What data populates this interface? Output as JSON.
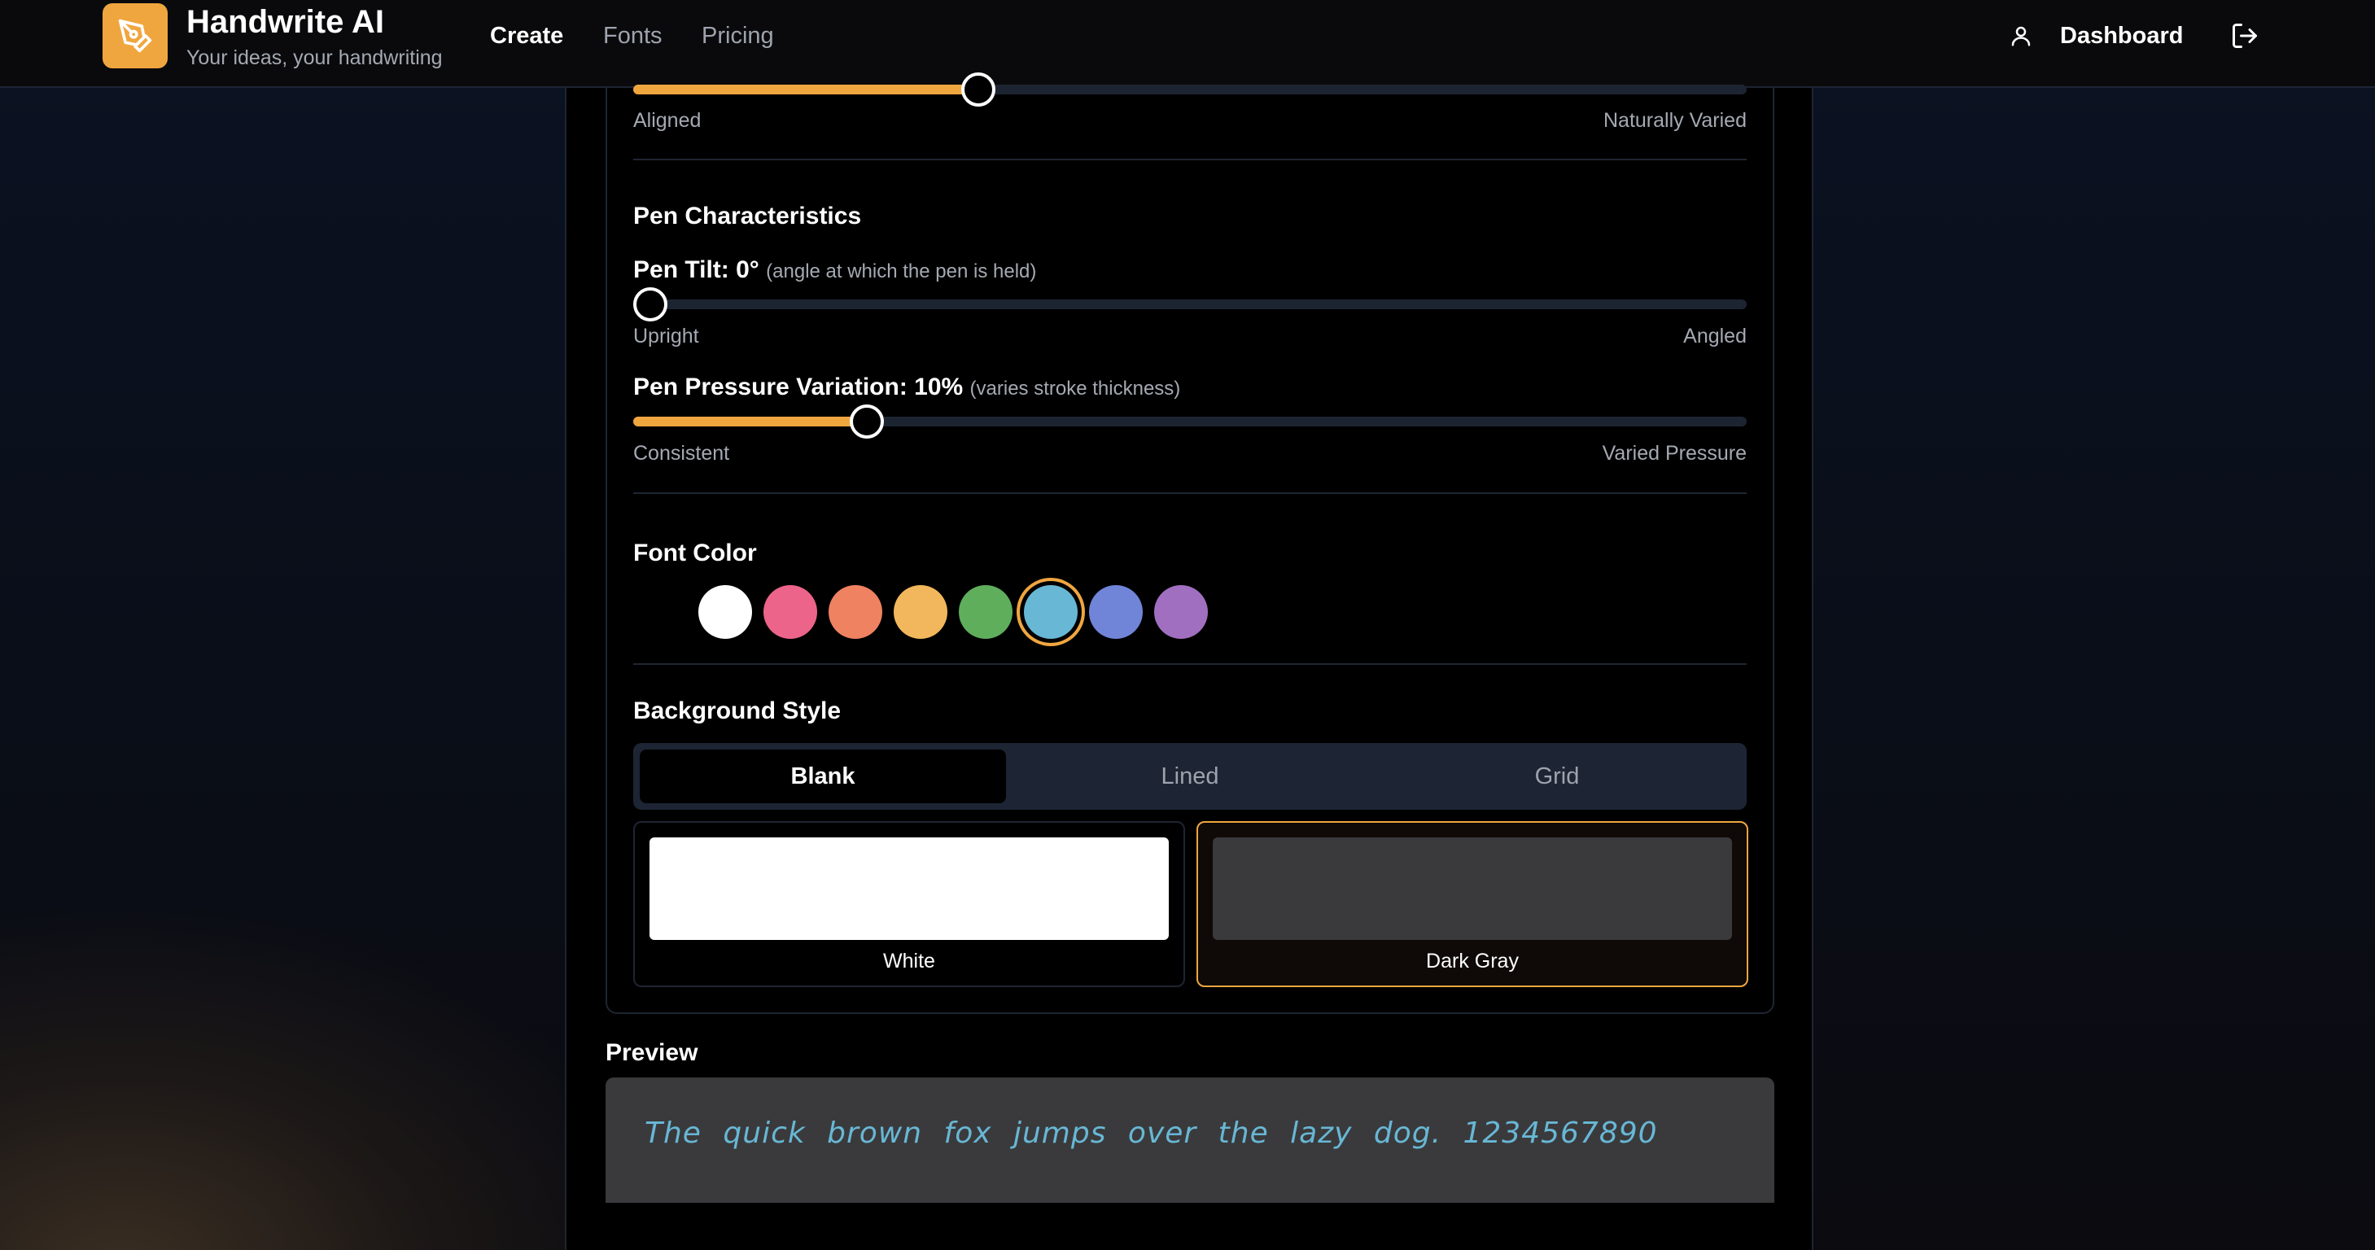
{
  "header": {
    "brand_title": "Handwrite AI",
    "brand_subtitle": "Your ideas, your handwriting",
    "nav": [
      "Create",
      "Fonts",
      "Pricing"
    ],
    "active_nav": "Create",
    "dashboard_label": "Dashboard",
    "icons": {
      "logo": "pen-nib-icon",
      "user": "user-icon",
      "logout": "logout-icon"
    },
    "accent_color": "#f0a63f"
  },
  "baseline": {
    "value_fraction": 0.31,
    "min_label": "Aligned",
    "max_label": "Naturally Varied"
  },
  "pen": {
    "section_title": "Pen Characteristics",
    "tilt": {
      "label": "Pen Tilt: 0°",
      "hint": "(angle at which the pen is held)",
      "value_fraction": 0.0,
      "min_label": "Upright",
      "max_label": "Angled"
    },
    "pressure": {
      "label": "Pen Pressure Variation: 10%",
      "hint": "(varies stroke thickness)",
      "value_fraction": 0.21,
      "min_label": "Consistent",
      "max_label": "Varied Pressure"
    }
  },
  "font_color": {
    "section_title": "Font Color",
    "swatches": [
      "#ffffff",
      "#ec6489",
      "#ef8261",
      "#f2b75c",
      "#5fae5c",
      "#68b7d5",
      "#7084d8",
      "#a06fc0"
    ],
    "selected": "#68b7d5"
  },
  "background": {
    "section_title": "Background Style",
    "tabs": [
      "Blank",
      "Lined",
      "Grid"
    ],
    "active_tab": "Blank",
    "options": [
      {
        "name": "White",
        "color": "#ffffff",
        "selected": false
      },
      {
        "name": "Dark Gray",
        "color": "#3a3a3c",
        "selected": true
      }
    ]
  },
  "preview": {
    "title": "Preview",
    "text": "The quick brown fox jumps over the lazy dog. 1234567890",
    "text_color": "#68b7d5",
    "background_color": "#3a3a3c"
  }
}
